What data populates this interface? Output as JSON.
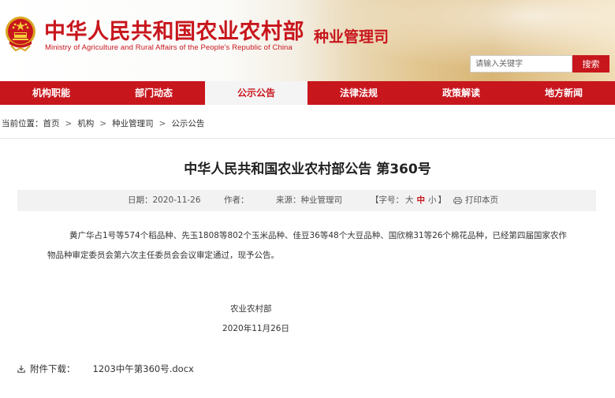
{
  "header": {
    "title": "中华人民共和国农业农村部",
    "subtitle": "Ministry of Agriculture and Rural Affairs of the People's Republic of China",
    "department": "种业管理司",
    "search": {
      "placeholder": "请输入关键字",
      "button": "搜索"
    },
    "colors": {
      "brand_red": "#c8161d"
    }
  },
  "nav": {
    "items": [
      {
        "label": "机构职能"
      },
      {
        "label": "部门动态"
      },
      {
        "label": "公示公告"
      },
      {
        "label": "法律法规"
      },
      {
        "label": "政策解读"
      },
      {
        "label": "地方新闻"
      }
    ],
    "active_index": 2
  },
  "breadcrumb": {
    "prefix": "当前位置：",
    "items": [
      "首页",
      "机构",
      "种业管理司",
      "公示公告"
    ],
    "separator": ">"
  },
  "article": {
    "title": "中华人民共和国农业农村部公告 第360号",
    "meta": {
      "date": "日期：2020-11-26",
      "author": "作者：",
      "source": "来源：种业管理司",
      "font_size_prefix": "【字号：",
      "font_large": "大",
      "font_medium": "中",
      "font_small": "小",
      "font_size_suffix": "】",
      "print": "打印本页"
    },
    "body": "黄广华占1号等574个稻品种、先玉1808等802个玉米品种、佳豆36等48个大豆品种、国欣棉31等26个棉花品种，已经第四届国家农作物品种审定委员会第六次主任委员会会议审定通过，现予公告。",
    "signature_org": "农业农村部",
    "signature_date": "2020年11月26日",
    "attachment": {
      "label": "附件下载：",
      "file": "1203中午第360号.docx"
    }
  }
}
